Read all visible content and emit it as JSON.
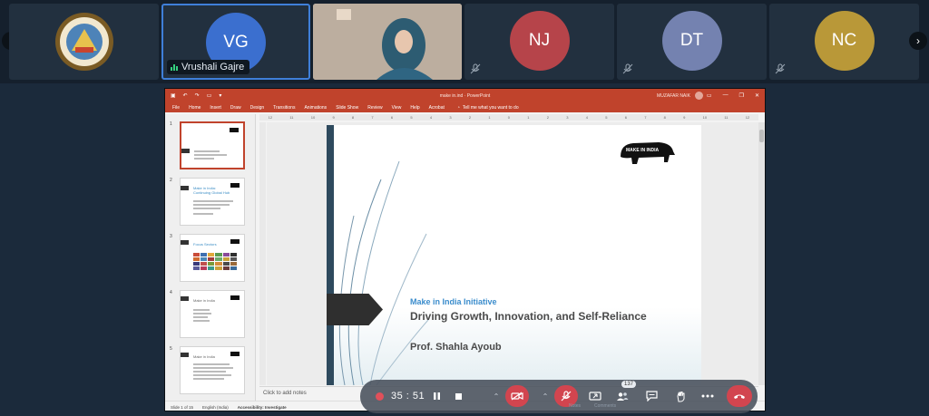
{
  "colors": {
    "brand_red": "#c0432c",
    "avatar_vg": "#3b6fcf",
    "avatar_nj": "#b6444a",
    "avatar_dt": "#7482b0",
    "avatar_nc": "#b99838",
    "leave_red": "#d2454f"
  },
  "participants": [
    {
      "type": "logo",
      "icon": "college-emblem-logo"
    },
    {
      "initials": "VG",
      "name": "Vrushali Gajre",
      "speaking": true
    },
    {
      "type": "video"
    },
    {
      "initials": "NJ",
      "muted": true
    },
    {
      "initials": "DT",
      "muted": true
    },
    {
      "initials": "NC",
      "muted": true
    }
  ],
  "powerpoint": {
    "doc_title": "make in.ind · PowerPoint",
    "user_name": "MUZAFAR NAIK",
    "menu": [
      "File",
      "Home",
      "Insert",
      "Draw",
      "Design",
      "Transitions",
      "Animations",
      "Slide Show",
      "Review",
      "View",
      "Help",
      "Acrobat"
    ],
    "tell_me": "Tell me what you want to do",
    "ruler_ticks": [
      "12",
      "11",
      "10",
      "9",
      "8",
      "7",
      "6",
      "5",
      "4",
      "3",
      "2",
      "1",
      "0",
      "1",
      "2",
      "3",
      "4",
      "5",
      "6",
      "7",
      "8",
      "9",
      "10",
      "11",
      "12"
    ],
    "thumbnails": [
      {
        "number": "1",
        "selected": true
      },
      {
        "number": "2",
        "heading": "Make in India: Continuing Global Hub"
      },
      {
        "number": "3",
        "heading": "Focus Sectors"
      },
      {
        "number": "4",
        "heading": "Make in India"
      },
      {
        "number": "5",
        "heading": "Make in India"
      }
    ],
    "slide": {
      "kicker": "Make in India Initiative",
      "title": "Driving Growth, Innovation, and Self-Reliance",
      "author": "Prof. Shahla Ayoub",
      "logo_text": "MAKE IN INDIA"
    },
    "notes_placeholder": "Click to add notes",
    "status": {
      "slide_info": "Slide 1 of 15",
      "language": "English (India)",
      "accessibility": "Accessibility: Investigate",
      "notes": "Notes",
      "comments": "Comments"
    }
  },
  "meeting_toolbar": {
    "timer": "35 : 51",
    "participants_count": "137"
  }
}
